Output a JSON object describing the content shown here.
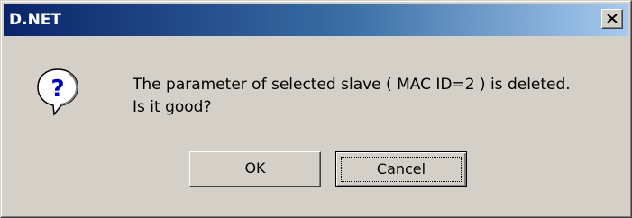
{
  "window": {
    "title": "D.NET",
    "close_icon": "close-icon"
  },
  "message": {
    "icon": "question-icon",
    "line1": "The parameter of selected slave ( MAC ID=2 ) is deleted.",
    "line2": "Is it good?"
  },
  "buttons": {
    "ok_label": "OK",
    "cancel_label": "Cancel"
  },
  "colors": {
    "title_gradient_start": "#0a246a",
    "title_gradient_end": "#a6caf0",
    "dialog_face": "#d4d0c8",
    "icon_blue": "#0000c0"
  }
}
